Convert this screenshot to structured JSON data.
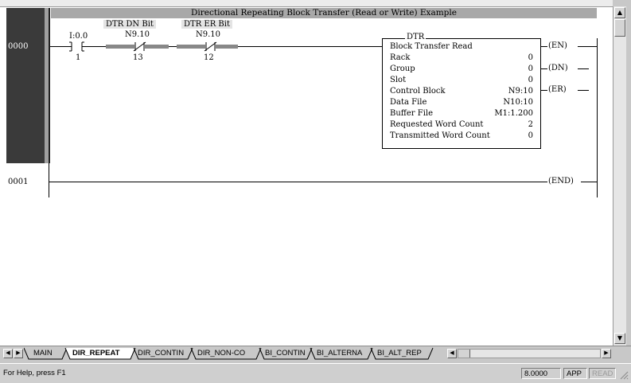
{
  "rung_title": "Directional Repeating Block Transfer (Read or Write) Example",
  "rungs": [
    {
      "number": "0000"
    },
    {
      "number": "0001"
    }
  ],
  "contacts": [
    {
      "header": "",
      "address": "I:0.0",
      "bit": "1"
    },
    {
      "header": "DTR DN Bit",
      "address": "N9.10",
      "bit": "13"
    },
    {
      "header": "DTR ER Bit",
      "address": "N9.10",
      "bit": "12"
    }
  ],
  "instruction": {
    "mnemonic": "DTR",
    "title": "Block Transfer Read",
    "params": [
      {
        "label": "Rack",
        "value": "0"
      },
      {
        "label": "Group",
        "value": "0"
      },
      {
        "label": "Slot",
        "value": "0"
      },
      {
        "label": "Control Block",
        "value": "N9:10"
      },
      {
        "label": "Data File",
        "value": "N10:10"
      },
      {
        "label": "Buffer File",
        "value": "M1:1.200"
      },
      {
        "label": "Requested Word Count",
        "value": "2"
      },
      {
        "label": "Transmitted Word Count",
        "value": "0"
      }
    ]
  },
  "coils": [
    "EN",
    "DN",
    "ER"
  ],
  "end_label": "END",
  "tabs": [
    "MAIN",
    "DIR_REPEAT",
    "DIR_CONTIN",
    "DIR_NON-CO",
    "BI_CONTIN",
    "BI_ALTERNA",
    "BI_ALT_REP"
  ],
  "active_tab": "DIR_REPEAT",
  "status": {
    "help": "For Help, press F1",
    "zoom": "8.0000",
    "app": "APP",
    "read": "READ"
  }
}
